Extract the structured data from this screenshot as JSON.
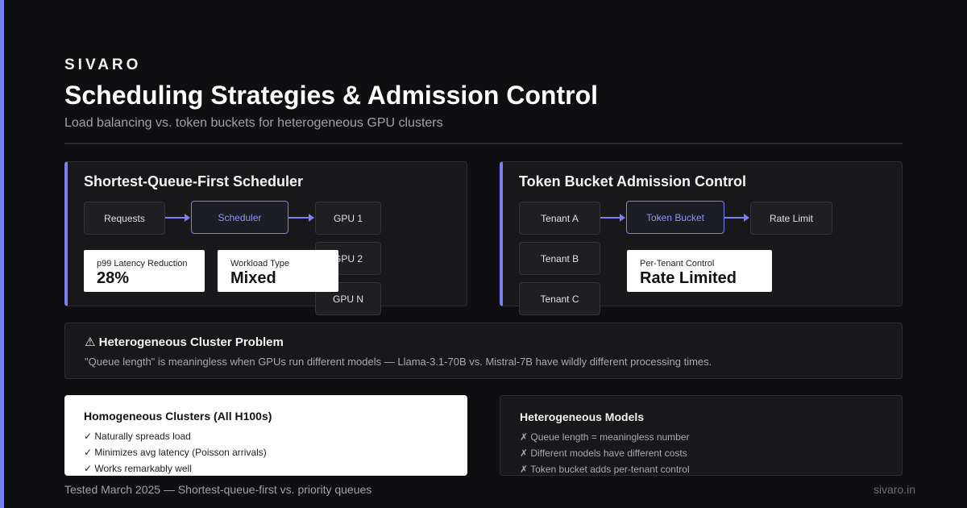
{
  "brand": "SIVARO",
  "title": "Scheduling Strategies & Admission Control",
  "subtitle": "Load balancing vs. token buckets for heterogeneous GPU clusters",
  "colors": {
    "accent": "#7b80f0",
    "background": "#0f0f11",
    "panel": "#18181b"
  },
  "left_panel": {
    "title": "Shortest-Queue-First Scheduler",
    "nodes": {
      "requests": "Requests",
      "scheduler": "Scheduler",
      "gpu1": "GPU 1",
      "gpu2": "GPU 2",
      "gpun": "GPU N"
    },
    "stats": [
      {
        "label": "p99 Latency Reduction",
        "value": "28%"
      },
      {
        "label": "Workload Type",
        "value": "Mixed"
      }
    ]
  },
  "right_panel": {
    "title": "Token Bucket Admission Control",
    "nodes": {
      "tenant_a": "Tenant A",
      "tenant_b": "Tenant B",
      "tenant_c": "Tenant C",
      "bucket": "Token Bucket",
      "rate_limit": "Rate Limit"
    },
    "stats": [
      {
        "label": "Per-Tenant Control",
        "value": "Rate Limited"
      }
    ]
  },
  "problem": {
    "icon": "warning-icon",
    "title": "⚠ Heterogeneous Cluster Problem",
    "text": "\"Queue length\" is meaningless when GPUs run different models — Llama-3.1-70B vs. Mistral-7B have wildly different processing times."
  },
  "homogeneous": {
    "title": "Homogeneous Clusters (All H100s)",
    "items": [
      "✓ Naturally spreads load",
      "✓ Minimizes avg latency (Poisson arrivals)",
      "✓ Works remarkably well"
    ]
  },
  "heterogeneous": {
    "title": "Heterogeneous Models",
    "items": [
      "✗ Queue length = meaningless number",
      "✗ Different models have different costs",
      "✗ Token bucket adds per-tenant control"
    ]
  },
  "footer": {
    "note": "Tested March 2025 — Shortest-queue-first vs. priority queues",
    "site": "sivaro.in"
  }
}
